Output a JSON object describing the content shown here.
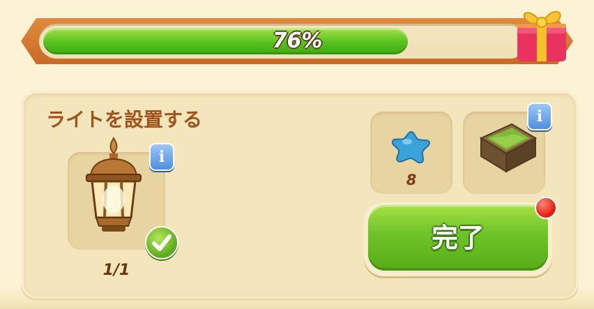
{
  "progress": {
    "percent_label": "76%",
    "value": 0.76
  },
  "task": {
    "title": "ライトを設置する",
    "item_count": "1/1",
    "item_icon": "lantern-icon",
    "item_done": true
  },
  "rewards": [
    {
      "icon": "blue-star-gem-icon",
      "count": "8"
    },
    {
      "icon": "grass-planter-icon"
    }
  ],
  "complete_button": {
    "label": "完了"
  },
  "info_label": "i",
  "colors": {
    "title": "#a0531a",
    "progress_fill": "#55c21d",
    "button": "#6cc326",
    "notify": "#e31d10"
  }
}
